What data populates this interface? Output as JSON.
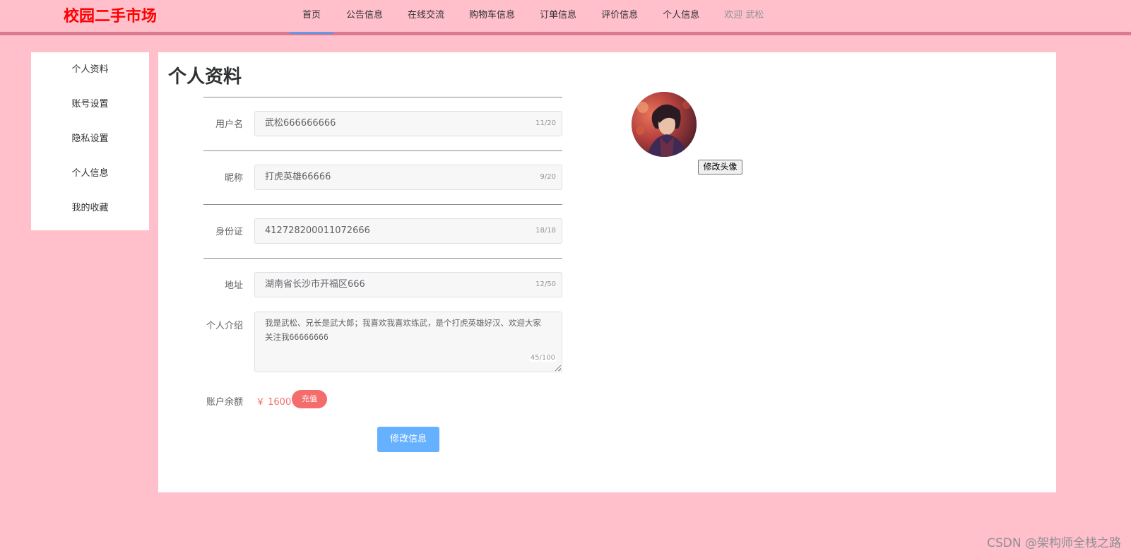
{
  "header": {
    "logo": "校园二手市场",
    "nav": [
      {
        "label": "首页"
      },
      {
        "label": "公告信息"
      },
      {
        "label": "在线交流"
      },
      {
        "label": "购物车信息"
      },
      {
        "label": "订单信息"
      },
      {
        "label": "评价信息"
      },
      {
        "label": "个人信息"
      }
    ],
    "welcome": "欢迎 武松",
    "active_nav": "首页"
  },
  "sidebar": {
    "items": [
      {
        "label": "个人资料"
      },
      {
        "label": "账号设置"
      },
      {
        "label": "隐私设置"
      },
      {
        "label": "个人信息"
      },
      {
        "label": "我的收藏"
      }
    ]
  },
  "main": {
    "title": "个人资料",
    "fields": {
      "username": {
        "label": "用户名",
        "value": "武松666666666",
        "counter": "11/20"
      },
      "nickname": {
        "label": "昵称",
        "value": "打虎英雄66666",
        "counter": "9/20"
      },
      "id_card": {
        "label": "身份证",
        "value": "412728200011072666",
        "counter": "18/18"
      },
      "address": {
        "label": "地址",
        "value": "湖南省长沙市开福区666",
        "counter": "12/50"
      },
      "intro": {
        "label": "个人介绍",
        "value": "我是武松、兄长是武大郎；我喜欢我喜欢练武，是个打虎英雄好汉、欢迎大家关注我66666666",
        "counter": "45/100"
      }
    },
    "balance": {
      "label": "账户余额",
      "value": "￥ 1600",
      "recharge_label": "充值"
    },
    "submit_label": "修改信息",
    "avatar_button": "修改头像"
  },
  "colors": {
    "page_background": "#ffbfcb",
    "header_border": "#da7a92",
    "logo": "#ff0000",
    "danger": "#f56c6c",
    "primary_light": "#66b1ff",
    "active_underline": "#409eff"
  },
  "watermark": "CSDN @架构师全栈之路"
}
